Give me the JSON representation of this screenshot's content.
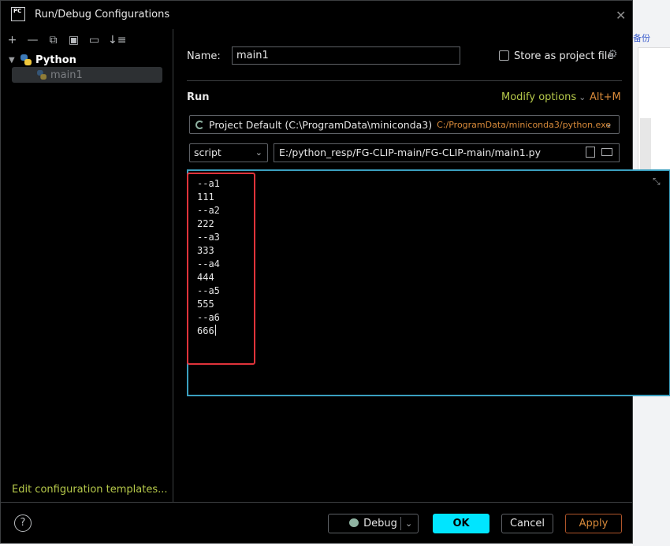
{
  "background_app": {
    "side_text": "备份"
  },
  "dialog": {
    "title": "Run/Debug Configurations",
    "logo_text": "PC",
    "close_glyph": "✕"
  },
  "toolbar": {
    "add": "+",
    "remove": "—",
    "copy": "⧉",
    "save": "▣",
    "folder": "▭",
    "sort": "↓≡"
  },
  "tree": {
    "group": "Python",
    "items": [
      {
        "label": "main1",
        "selected": true
      }
    ]
  },
  "left_footer": {
    "edit_templates": "Edit configuration templates..."
  },
  "form": {
    "name_label": "Name:",
    "name_value": "main1",
    "store_label": "Store as project file",
    "store_checked": false,
    "run_heading": "Run",
    "modify_options": "Modify options",
    "modify_shortcut": "Alt+M",
    "interpreter_main": "Project Default (C:\\ProgramData\\miniconda3)",
    "interpreter_path": "C:/ProgramData/miniconda3/python.exe",
    "run_mode": "script",
    "script_path": "E:/python_resp/FG-CLIP-main/FG-CLIP-main/main1.py"
  },
  "parameters": {
    "lines": [
      "--a1",
      "111",
      "--a2",
      "222",
      "--a3",
      "333",
      "--a4",
      "444",
      "--a5",
      "555",
      "--a6",
      "666"
    ]
  },
  "footer": {
    "help": "?",
    "debug": "Debug",
    "ok": "OK",
    "cancel": "Cancel",
    "apply": "Apply"
  },
  "colors": {
    "accent_ok": "#00e5ff",
    "link_green": "#b6c94a",
    "orange": "#d88a3a",
    "highlight_red": "#e0333a",
    "focus_border": "#3a9fbf"
  },
  "icons": [
    "app-logo-icon",
    "close-icon",
    "python-icon",
    "spinner-icon",
    "chevron-down-icon",
    "gear-icon",
    "file-icon",
    "folder-icon",
    "collapse-icon",
    "help-icon",
    "bug-icon"
  ]
}
